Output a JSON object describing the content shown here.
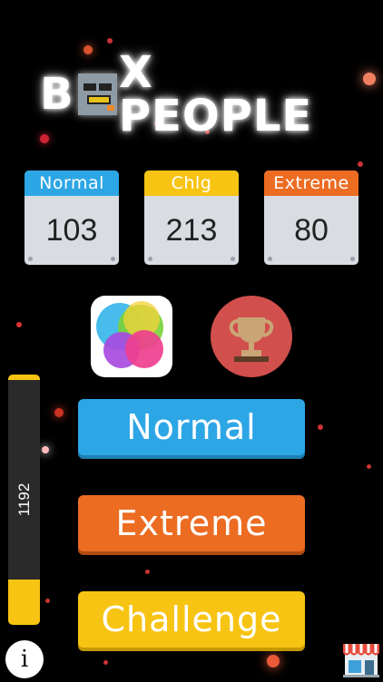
{
  "title": {
    "first": "B",
    "rest": "X PEOPLE"
  },
  "scores": [
    {
      "label": "Normal",
      "value": "103",
      "color": "#2da6e6"
    },
    {
      "label": "Chlg",
      "value": "213",
      "color": "#f7c414"
    },
    {
      "label": "Extreme",
      "value": "80",
      "color": "#ec6c22"
    }
  ],
  "icons": {
    "game_center": "game-center-icon",
    "leaderboard": "trophy-icon",
    "info": "info-icon",
    "shop": "shop-icon"
  },
  "info_label": "i",
  "meter": {
    "value": "1192",
    "level": 0.18
  },
  "buttons": {
    "normal": {
      "label": "Normal",
      "color": "#2da6e6"
    },
    "extreme": {
      "label": "Extreme",
      "color": "#ec6c22"
    },
    "challenge": {
      "label": "Challenge",
      "color": "#f7c414"
    }
  }
}
